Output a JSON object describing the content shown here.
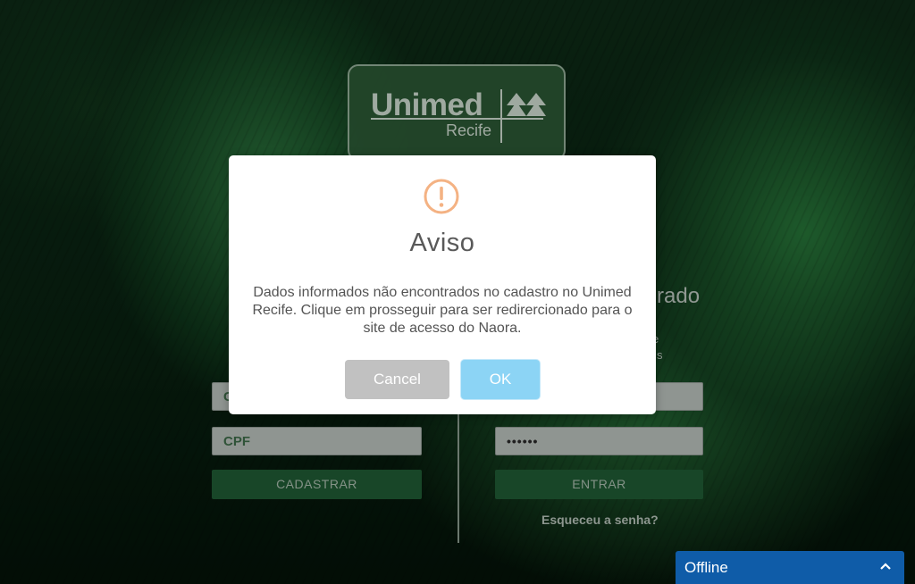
{
  "logo": {
    "name": "Unimed",
    "sub": "Recife"
  },
  "register": {
    "field1_text": "C",
    "cpf_placeholder": "CPF",
    "button_label": "CADASTRAR"
  },
  "login": {
    "heading_partial": "rado",
    "line1_partial": "e",
    "line2_partial": "s",
    "password_value": "••••••",
    "button_label": "ENTRAR",
    "forgot_label": "Esqueceu a senha?"
  },
  "modal": {
    "icon": "exclamation-circle-icon",
    "title": "Aviso",
    "message": "Dados informados não encontrados no cadastro no Unimed Recife. Clique em prosseguir para ser redirercionado para o site de acesso do Naora.",
    "cancel_label": "Cancel",
    "ok_label": "OK",
    "warning_color": "#f4b283",
    "ok_color": "#8cd4f5",
    "cancel_color": "#c1c1c1"
  },
  "chat": {
    "status_label": "Offline",
    "color": "#0f5ca8",
    "icon": "chevron-up-icon"
  },
  "colors": {
    "brand_green": "#1f5a34"
  }
}
